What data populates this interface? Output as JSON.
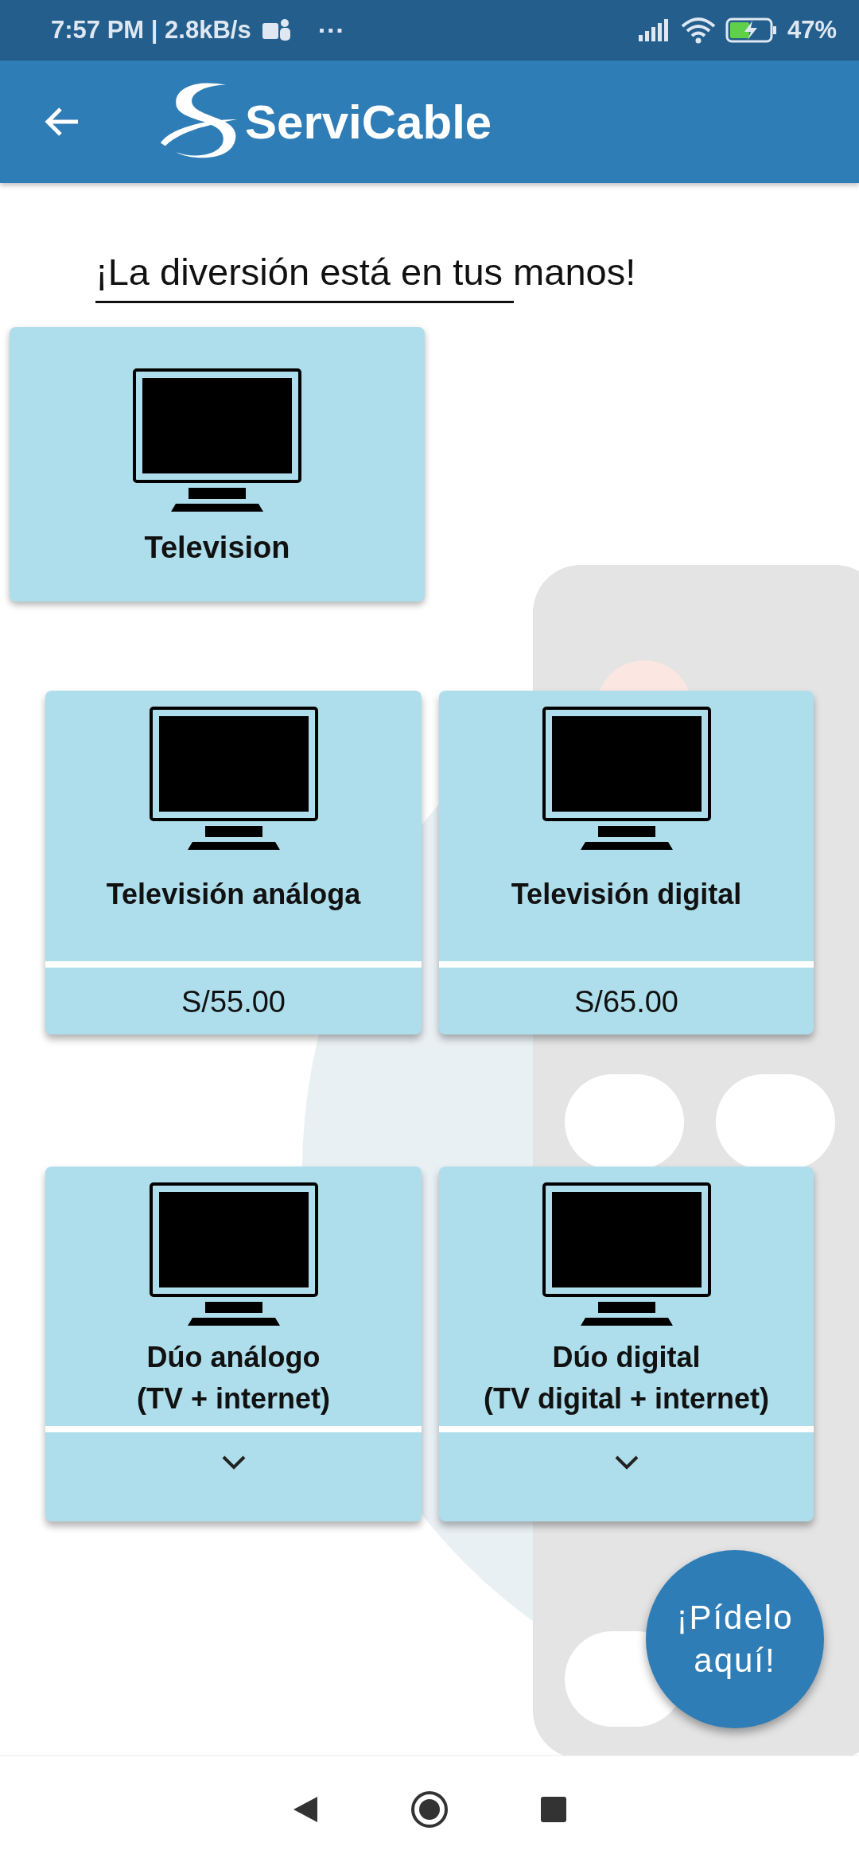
{
  "status_bar": {
    "time_speed": "7:57 PM | 2.8kB/s",
    "more": "···",
    "battery": "47%"
  },
  "header": {
    "brand": "ServiCable"
  },
  "heading": "¡La diversión está en tus manos!",
  "category": {
    "label": "Television"
  },
  "products": [
    {
      "kind": "price",
      "title": "Televisión análoga",
      "price": "S/55.00"
    },
    {
      "kind": "price",
      "title": "Televisión digital",
      "price": "S/65.00"
    },
    {
      "kind": "expand",
      "title": "Dúo análogo",
      "subtitle": "(TV + internet)",
      "expanded": false
    },
    {
      "kind": "expand",
      "title": "Dúo digital",
      "subtitle": "(TV digital + internet)",
      "expanded": false
    }
  ],
  "fab": "¡Pídelo aquí!"
}
